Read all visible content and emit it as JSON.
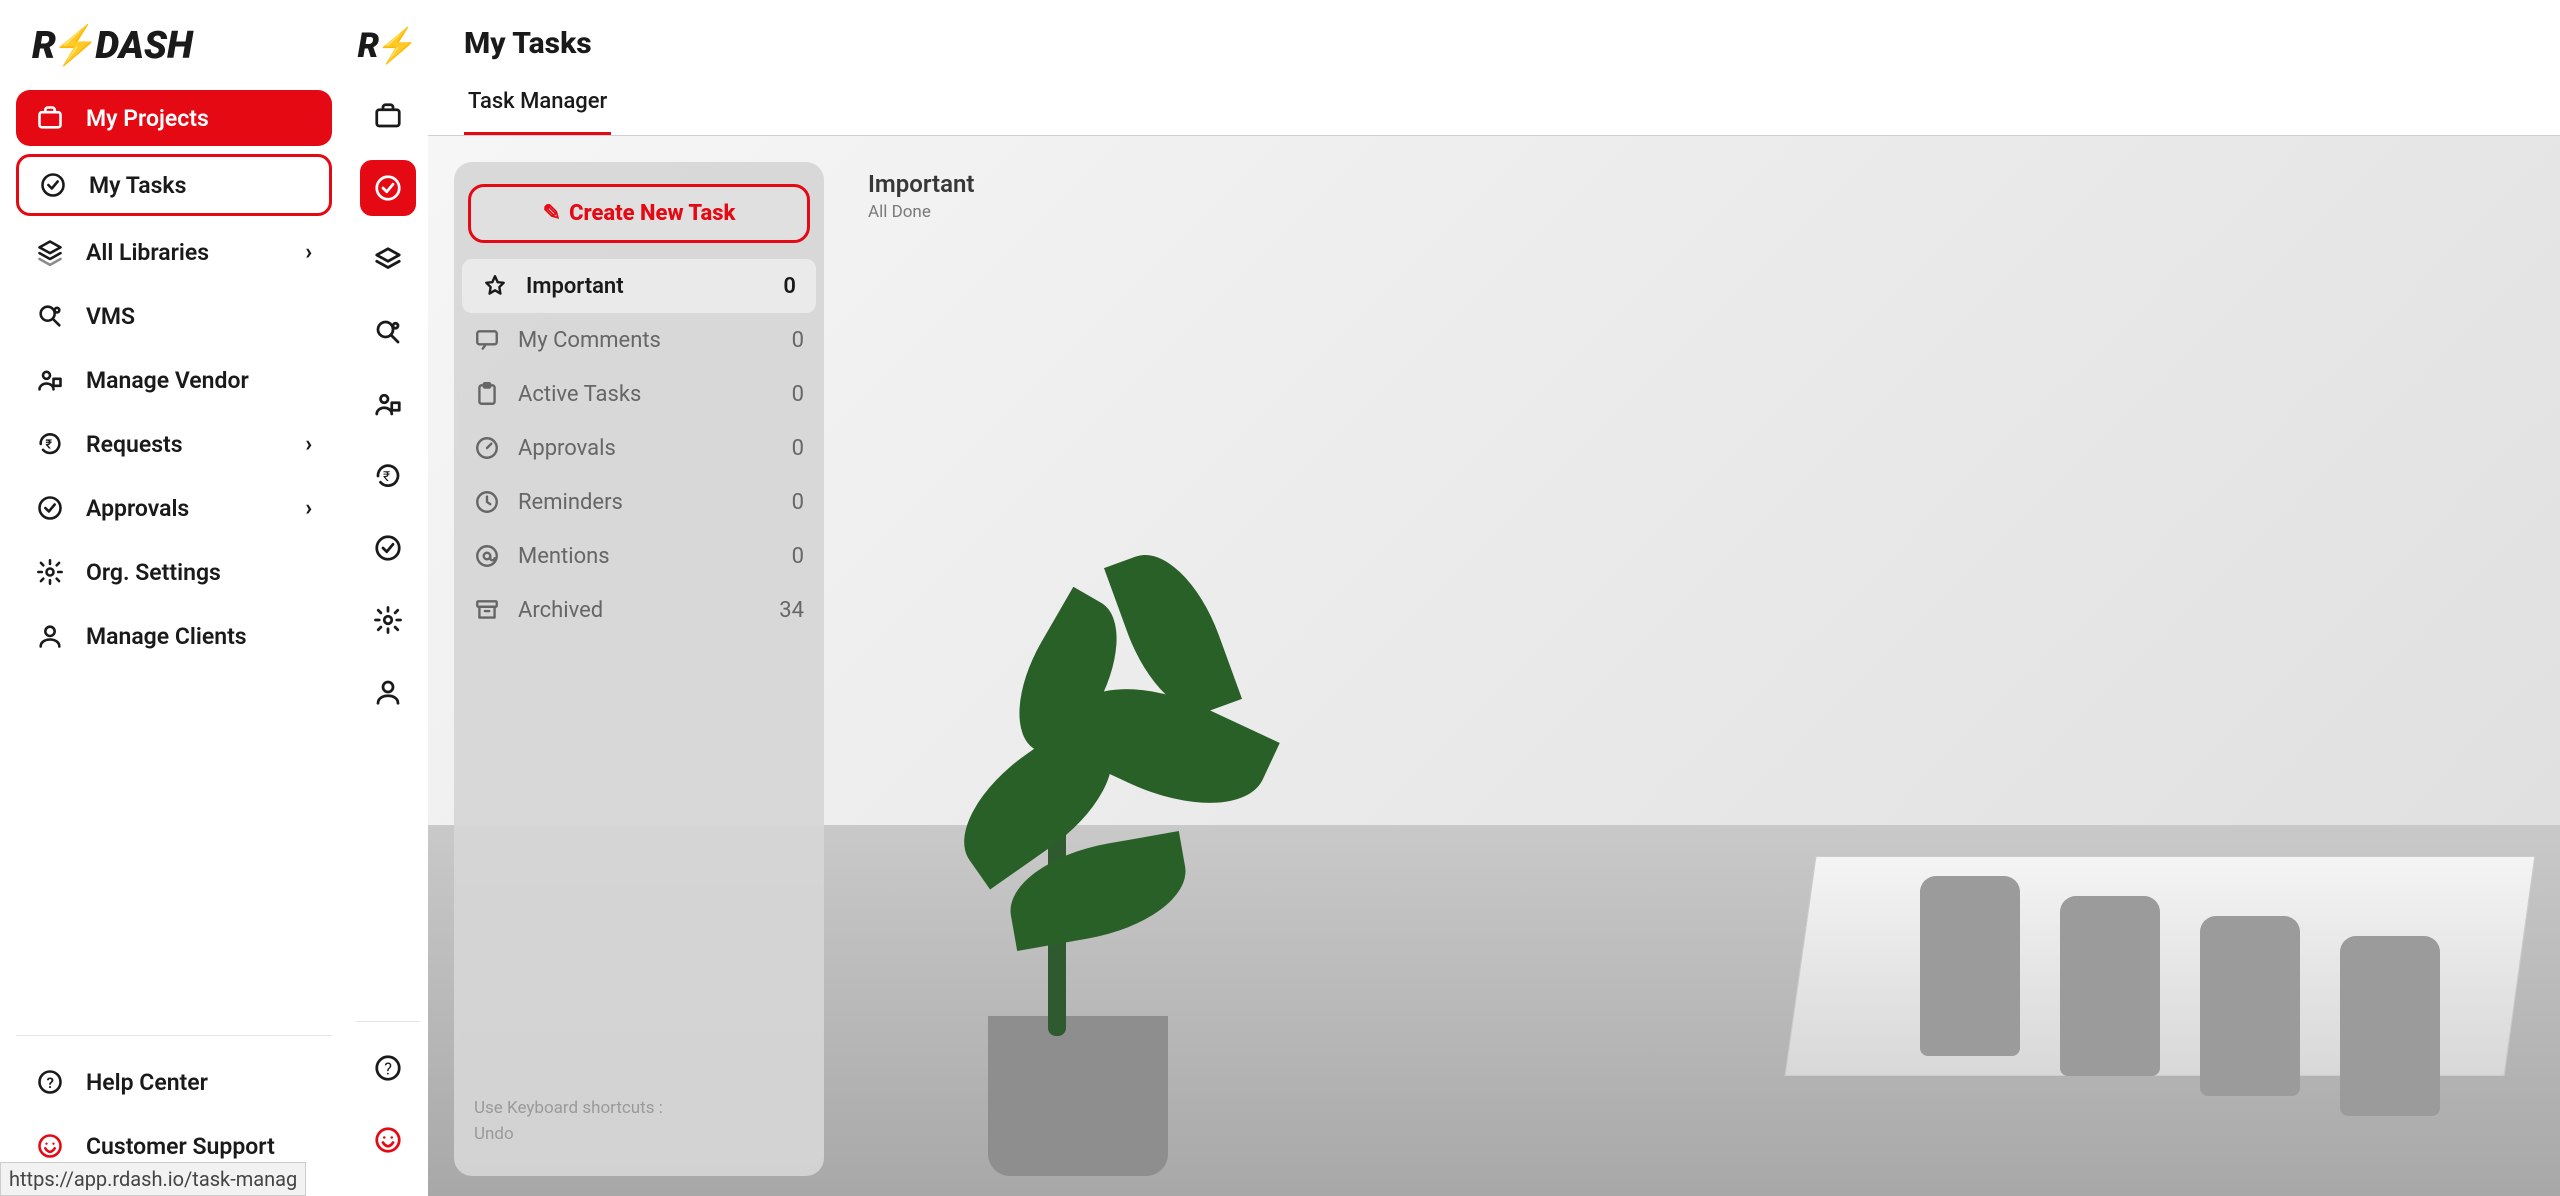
{
  "brand": {
    "name_part1": "R",
    "name_part2": "DASH"
  },
  "page_title": "My Tasks",
  "tab_label": "Task Manager",
  "url_hint": "https://app.rdash.io/task-manag",
  "sidebar": {
    "items": [
      {
        "label": "My Projects",
        "icon": "briefcase-icon",
        "expandable": false
      },
      {
        "label": "My Tasks",
        "icon": "check-circle-icon",
        "expandable": false
      },
      {
        "label": "All Libraries",
        "icon": "layers-icon",
        "expandable": true
      },
      {
        "label": "VMS",
        "icon": "search-settings-icon",
        "expandable": false
      },
      {
        "label": "Manage Vendor",
        "icon": "vendor-icon",
        "expandable": false
      },
      {
        "label": "Requests",
        "icon": "rupee-cycle-icon",
        "expandable": true
      },
      {
        "label": "Approvals",
        "icon": "approval-icon",
        "expandable": true
      },
      {
        "label": "Org. Settings",
        "icon": "gear-icon",
        "expandable": false
      },
      {
        "label": "Manage Clients",
        "icon": "person-icon",
        "expandable": false
      }
    ],
    "footer": [
      {
        "label": "Help Center",
        "icon": "help-icon"
      },
      {
        "label": "Customer Support",
        "icon": "support-icon"
      }
    ]
  },
  "task_panel": {
    "create_label": "Create New Task",
    "hint_line1": "Use Keyboard shortcuts :",
    "hint_line2": "Undo",
    "categories": [
      {
        "label": "Important",
        "count": 0,
        "icon": "star-icon"
      },
      {
        "label": "My Comments",
        "count": 0,
        "icon": "comment-icon"
      },
      {
        "label": "Active Tasks",
        "count": 0,
        "icon": "clipboard-icon"
      },
      {
        "label": "Approvals",
        "count": 0,
        "icon": "gauge-icon"
      },
      {
        "label": "Reminders",
        "count": 0,
        "icon": "clock-icon"
      },
      {
        "label": "Mentions",
        "count": 0,
        "icon": "at-icon"
      },
      {
        "label": "Archived",
        "count": 34,
        "icon": "archive-icon"
      }
    ]
  },
  "important_panel": {
    "title": "Important",
    "subtitle": "All Done"
  }
}
